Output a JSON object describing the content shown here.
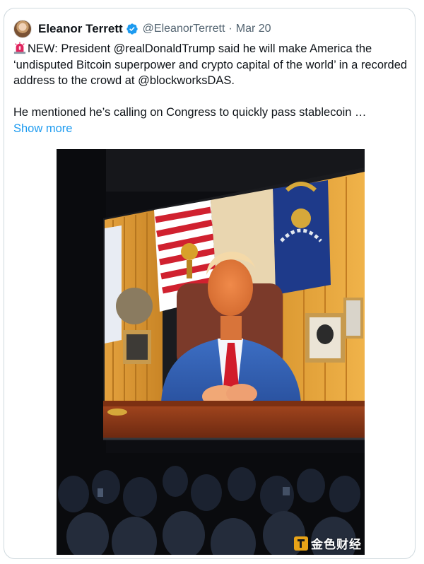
{
  "tweet": {
    "author_name": "Eleanor Terrett",
    "handle": "@EleanorTerrett",
    "separator": "·",
    "date": "Mar 20",
    "verified_icon": "verified-badge-icon",
    "alert_icon": "police-light-icon",
    "paragraph_1": "NEW: President @realDonaldTrump said he will make America the ‘undisputed Bitcoin superpower and crypto capital of the world’ in a recorded address to the crowd at @blockworksDAS.",
    "paragraph_2": "He mentioned he’s calling on Congress to quickly pass stablecoin …",
    "show_more": "Show more"
  },
  "media": {
    "icon": "photo-of-screen-at-conference"
  },
  "watermark": {
    "text": "金色财经",
    "icon": "jinse-logo-icon"
  },
  "colors": {
    "link": "#1d9bf0",
    "secondary_text": "#536471",
    "border": "#cfd9de",
    "verified": "#1d9bf0",
    "alert": "#e0245e"
  }
}
